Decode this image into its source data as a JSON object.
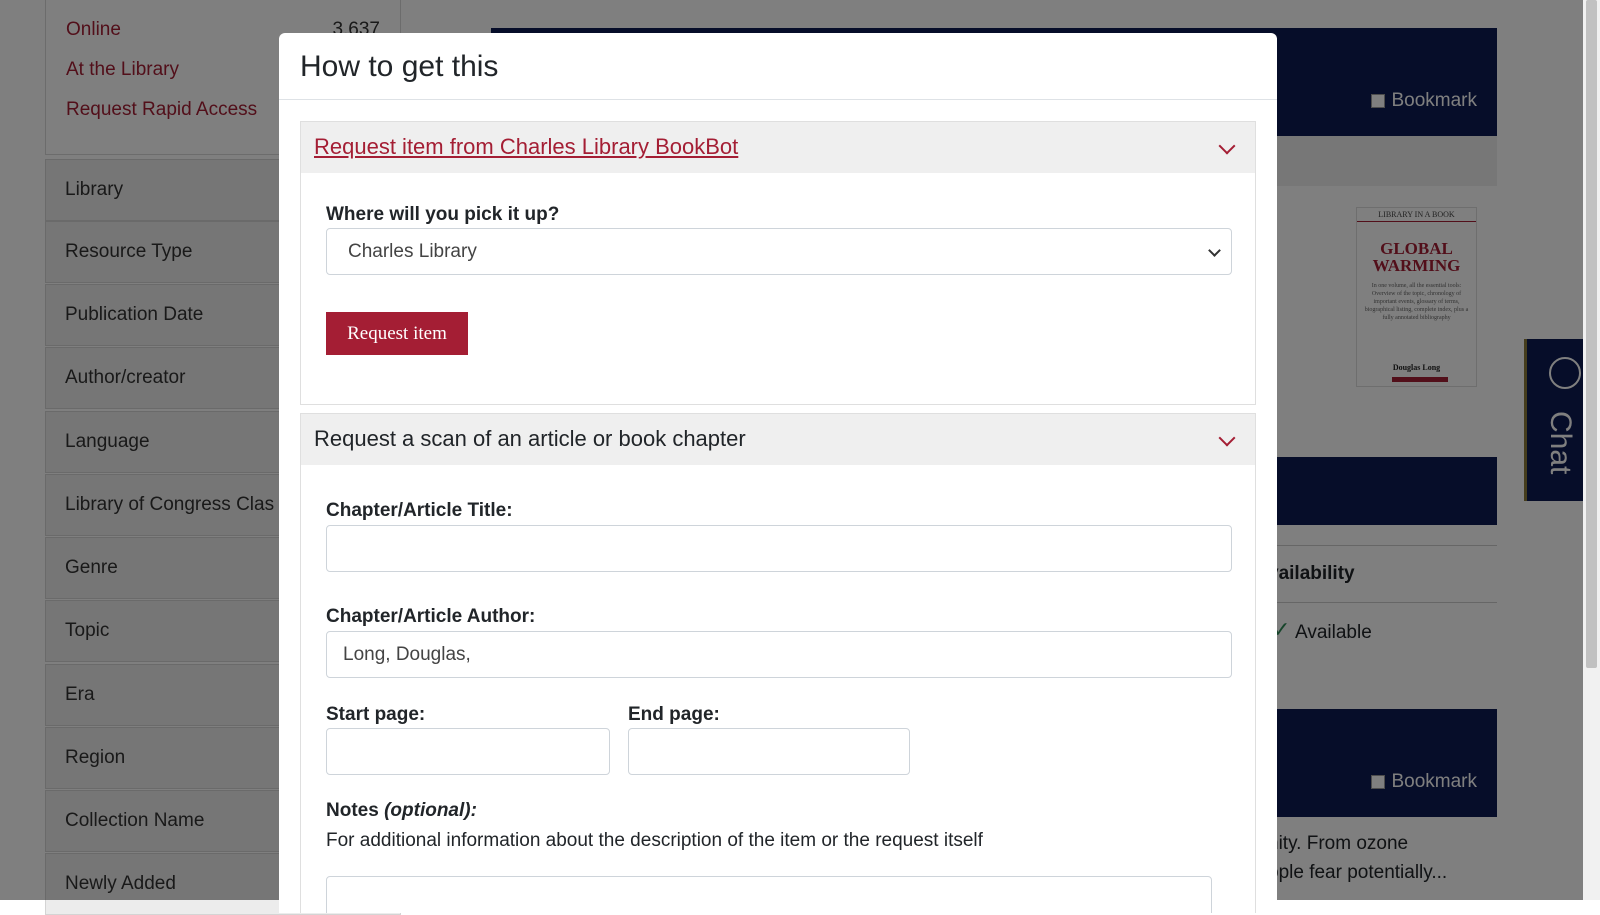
{
  "background": {
    "availability": [
      {
        "label": "Online",
        "count": "3,637"
      },
      {
        "label": "At the Library",
        "count": ""
      },
      {
        "label": "Request Rapid Access",
        "count": ""
      }
    ],
    "facets": [
      "Library",
      "Resource Type",
      "Publication Date",
      "Author/creator",
      "Language",
      "Library of Congress Clas",
      "Genre",
      "Topic",
      "Era",
      "Region",
      "Collection Name",
      "Newly Added"
    ],
    "bookmark_label": "Bookmark",
    "availability_heading": "vailability",
    "available_label": "Available",
    "snippet_line1": "nity. From ozone",
    "snippet_line2": "ople fear potentially...",
    "cover": {
      "series": "LIBRARY IN A BOOK",
      "title": "GLOBAL WARMING",
      "blurb": "In one volume, all the essential tools: Overview of the topic, chronology of important events, glossary of terms, biographical listing, complete index, plus a fully annotated bibliography",
      "author": "Douglas Long"
    },
    "chat_label": "Chat"
  },
  "modal": {
    "title": "How to get this",
    "bookbot": {
      "heading": "Request item from Charles Library BookBot",
      "pickup_label": "Where will you pick it up?",
      "pickup_value": "Charles Library",
      "request_button": "Request item"
    },
    "scan": {
      "heading": "Request a scan of an article or book chapter",
      "title_label": "Chapter/Article Title:",
      "title_value": "",
      "author_label": "Chapter/Article Author:",
      "author_value": "Long, Douglas,",
      "start_label": "Start page:",
      "end_label": "End page:",
      "notes_label": "Notes",
      "notes_optional": "(optional):",
      "notes_help": "For additional information about the description of the item or the request itself"
    }
  },
  "colors": {
    "accent": "#a41e34",
    "navy": "#0c1a52"
  }
}
